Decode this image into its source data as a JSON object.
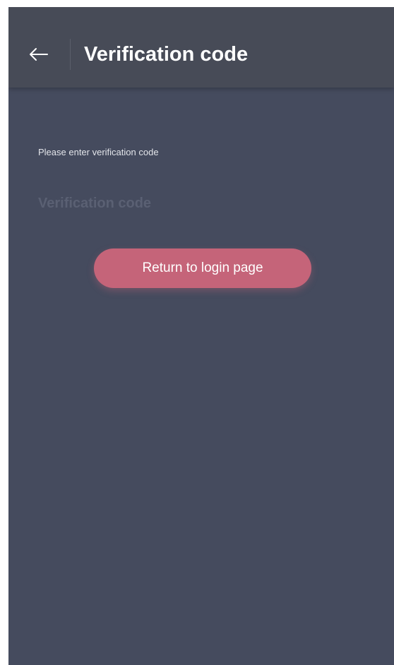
{
  "header": {
    "title": "Verification code",
    "back_icon": "arrow-left-icon"
  },
  "form": {
    "label": "Please enter verification code",
    "input_placeholder": "Verification code",
    "input_value": ""
  },
  "actions": {
    "return_label": "Return to login page"
  },
  "colors": {
    "background": "#454b5e",
    "header": "#474b57",
    "button": "#c56479",
    "text": "#ffffff",
    "placeholder": "#5a6073"
  }
}
